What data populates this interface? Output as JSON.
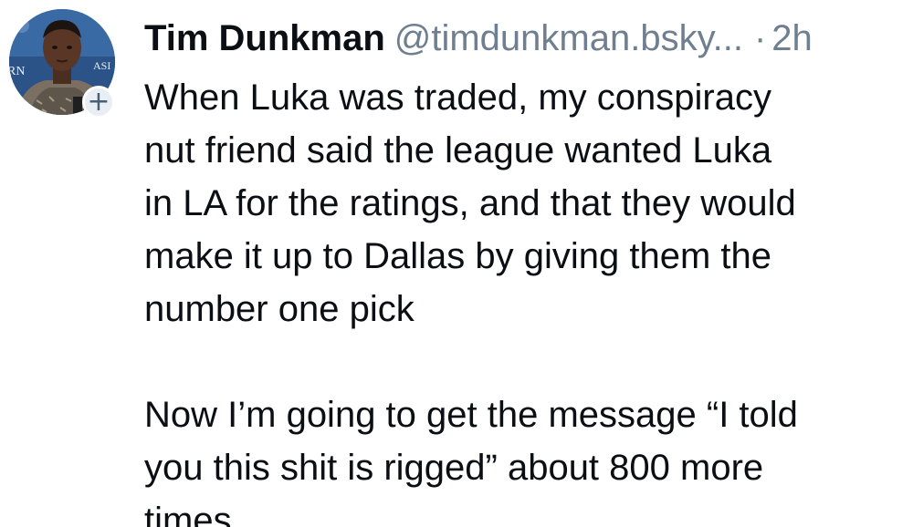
{
  "post": {
    "author_name": "Tim Dunkman",
    "author_handle": "@timdunkman.bsky...",
    "separator": "·",
    "timestamp": "2h",
    "follow_icon": "plus-icon",
    "follow_glyph": "+",
    "body_paragraphs": [
      [
        "When Luka was traded, my conspiracy",
        "nut friend said the league wanted Luka",
        "in LA for the ratings, and that they would",
        "make it up to Dallas by giving them the",
        "number one pick"
      ],
      [
        "Now I’m going to get the message “I told",
        "you this shit is rigged” about 800 more",
        "times"
      ]
    ]
  },
  "colors": {
    "text": "#0b0f14",
    "muted": "#6f7f90",
    "badge_bg": "#e9eef4"
  }
}
